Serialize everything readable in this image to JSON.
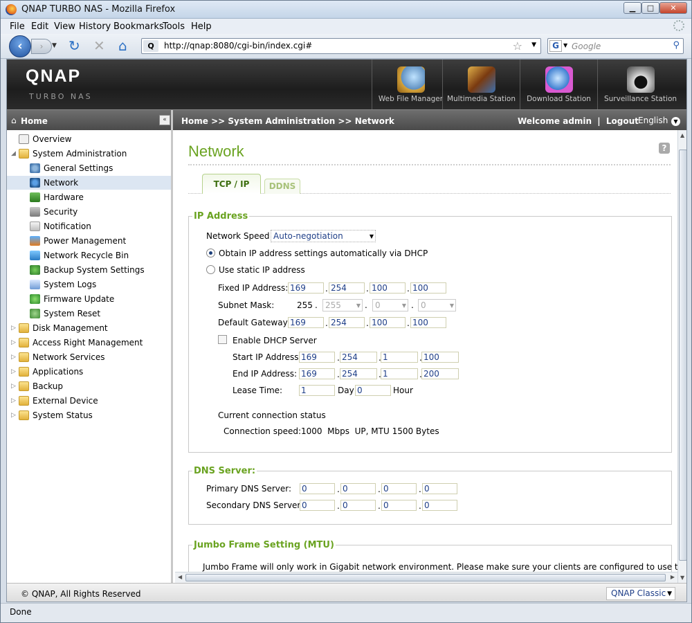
{
  "window": {
    "title": "QNAP TURBO NAS - Mozilla Firefox",
    "min": "▁",
    "max": "□",
    "close": "✕"
  },
  "menu": {
    "file": "File",
    "edit": "Edit",
    "view": "View",
    "history": "History",
    "bookmarks": "Bookmarks",
    "tools": "Tools",
    "help": "Help"
  },
  "nav": {
    "url": "http://qnap:8080/cgi-bin/index.cgi#",
    "search_placeholder": "Google"
  },
  "header": {
    "logo": "QNAP",
    "subtitle": "TURBO NAS",
    "apps": [
      {
        "label": "Web File Manager"
      },
      {
        "label": "Multimedia Station"
      },
      {
        "label": "Download Station"
      },
      {
        "label": "Surveillance Station"
      }
    ]
  },
  "bar": {
    "home": "Home",
    "breadcrumb": "Home >> System Administration >> Network",
    "welcome": "Welcome admin",
    "sep": "|",
    "logout": "Logout",
    "language": "English"
  },
  "sidebar": {
    "overview": "Overview",
    "sysadmin": "System Administration",
    "children": [
      "General Settings",
      "Network",
      "Hardware",
      "Security",
      "Notification",
      "Power Management",
      "Network Recycle Bin",
      "Backup System Settings",
      "System Logs",
      "Firmware Update",
      "System Reset"
    ],
    "groups": [
      "Disk Management",
      "Access Right Management",
      "Network Services",
      "Applications",
      "Backup",
      "External Device",
      "System Status"
    ]
  },
  "main": {
    "title": "Network",
    "help": "?",
    "tabs": {
      "tcpip": "TCP / IP",
      "ddns": "DDNS"
    },
    "ip_section": {
      "legend": "IP Address",
      "speed_label": "Network Speed",
      "speed_value": "Auto-negotiation",
      "dhcp_option": "Obtain IP address settings automatically via DHCP",
      "static_option": "Use static IP address",
      "fixed_ip_label": "Fixed IP Address:",
      "fixed_ip": [
        "169",
        "254",
        "100",
        "100"
      ],
      "subnet_label": "Subnet Mask:",
      "subnet": [
        "255",
        "255",
        "0",
        "0"
      ],
      "gateway_label": "Default Gateway:",
      "gateway": [
        "169",
        "254",
        "100",
        "100"
      ],
      "enable_dhcp": "Enable DHCP Server",
      "start_label": "Start IP Address:",
      "start_ip": [
        "169",
        "254",
        "1",
        "100"
      ],
      "end_label": "End IP Address:",
      "end_ip": [
        "169",
        "254",
        "1",
        "200"
      ],
      "lease_label": "Lease Time:",
      "lease_day": "1",
      "day": "Day",
      "lease_hour": "0",
      "hour": "Hour",
      "status_title": "Current connection status",
      "speed_status_label": "Connection speed:",
      "speed_status_value": "1000  Mbps  UP, MTU 1500 Bytes"
    },
    "dns_section": {
      "legend": "DNS Server:",
      "primary_label": "Primary DNS Server:",
      "primary": [
        "0",
        "0",
        "0",
        "0"
      ],
      "secondary_label": "Secondary DNS Server:",
      "secondary": [
        "0",
        "0",
        "0",
        "0"
      ]
    },
    "jumbo_section": {
      "legend": "Jumbo Frame Setting (MTU)",
      "text": "Jumbo Frame will only work in Gigabit network environment. Please make sure your clients are configured to use the"
    }
  },
  "footer": {
    "copyright": "© QNAP, All Rights Reserved",
    "theme": "QNAP Classic"
  },
  "status": "Done"
}
